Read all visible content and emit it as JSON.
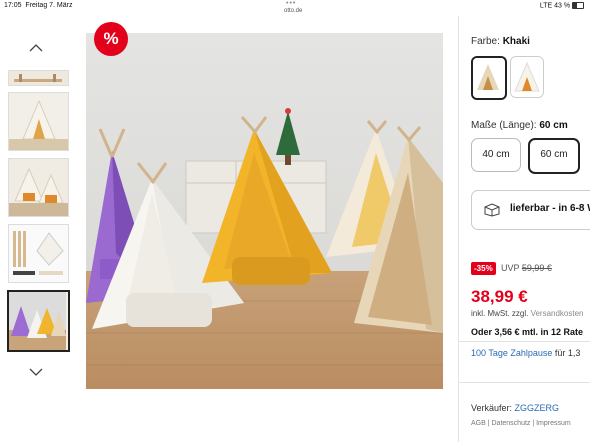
{
  "status": {
    "time": "17:05",
    "date": "Freitag 7. März",
    "url": "otto.de",
    "signal": "LTE 43 %"
  },
  "badge": {
    "sale_symbol": "%"
  },
  "icons": {
    "up": "chevron-up-icon",
    "down": "chevron-down-icon",
    "delivery": "package-box-icon"
  },
  "colors": {
    "sale_red": "#e3001b",
    "link_blue": "#2a6bb3"
  },
  "color_selector": {
    "label": "Farbe:",
    "value": "Khaki"
  },
  "size_selector": {
    "label": "Maße (Länge):",
    "value": "60 cm",
    "options": [
      "40 cm",
      "60 cm"
    ]
  },
  "delivery": {
    "text": "lieferbar - in 6-8 W"
  },
  "price": {
    "discount": "-35%",
    "uvp_label": "UVP",
    "uvp_value": "59,99 €",
    "current": "38,99 €",
    "tax_prefix": "inkl. MwSt. zzgl.",
    "tax_link": "Versandkosten",
    "financing": "Oder 3,56 € mtl. in 12 Rate"
  },
  "payment": {
    "link": "100 Tage Zahlpause",
    "suffix": "für 1,3"
  },
  "seller": {
    "label": "Verkäufer:",
    "name": "ZGGZERG",
    "legal": "AGB | Datenschutz | Impressum"
  }
}
